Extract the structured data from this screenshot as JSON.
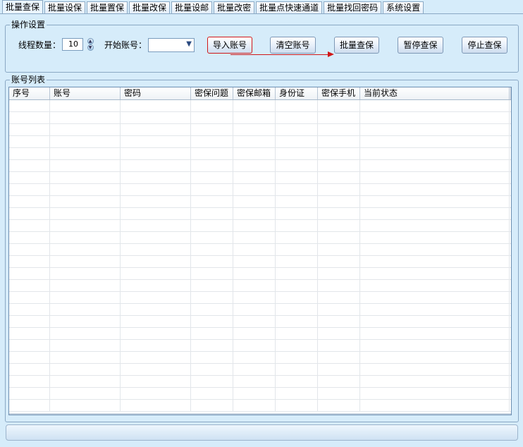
{
  "tabs": [
    "批量查保",
    "批量设保",
    "批量置保",
    "批量改保",
    "批量设邮",
    "批量改密",
    "批量点快速通道",
    "批量找回密码",
    "系统设置"
  ],
  "operation_group": {
    "title": "操作设置",
    "thread_label": "线程数量：",
    "thread_value": "10",
    "start_account_label": "开始账号：",
    "start_account_value": "",
    "buttons": {
      "import": "导入账号",
      "clear": "清空账号",
      "batch_check": "批量查保",
      "pause": "暂停查保",
      "stop": "停止查保"
    },
    "highlight_color": "#d01818"
  },
  "list_group": {
    "title": "账号列表",
    "columns": [
      "序号",
      "账号",
      "密码",
      "密保问题",
      "密保邮箱",
      "身份证",
      "密保手机",
      "当前状态"
    ],
    "rows": []
  },
  "status_text": ""
}
